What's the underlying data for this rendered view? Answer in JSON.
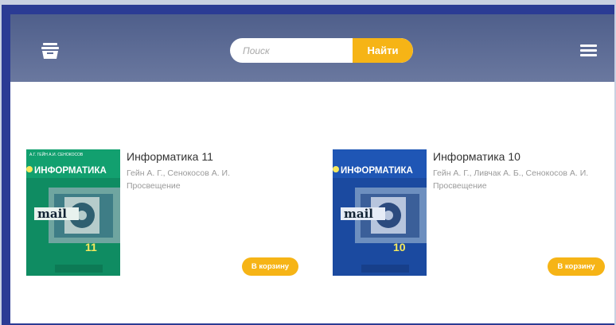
{
  "header": {
    "search_placeholder": "Поиск",
    "search_button": "Найти",
    "cart_icon": "basket-icon",
    "menu_icon": "hamburger-menu-icon"
  },
  "books": [
    {
      "title": "Информатика 11",
      "authors": "Гейн А. Г., Сенокосов А. И.",
      "publisher": "Просвещение",
      "button": "В корзину",
      "cover": {
        "top_authors": "А.Г. ГЕЙН  А.И. СЕНОКОСОВ",
        "title": "ИНФОРМАТИКА",
        "grade": "11",
        "word": "mail",
        "color": "#12a06f"
      }
    },
    {
      "title": "Информатика 10",
      "authors": "Гейн А. Г., Ливчак А. Б., Сенокосов А. И.",
      "publisher": "Просвещение",
      "button": "В корзину",
      "cover": {
        "title": "ИНФОРМАТИКА",
        "grade": "10",
        "word": "mail",
        "color": "#1f56b5"
      }
    }
  ],
  "colors": {
    "accent": "#f6b416",
    "header_top": "#4f5f8b",
    "header_bottom": "#6a789f",
    "frame": "#2b3b94"
  }
}
